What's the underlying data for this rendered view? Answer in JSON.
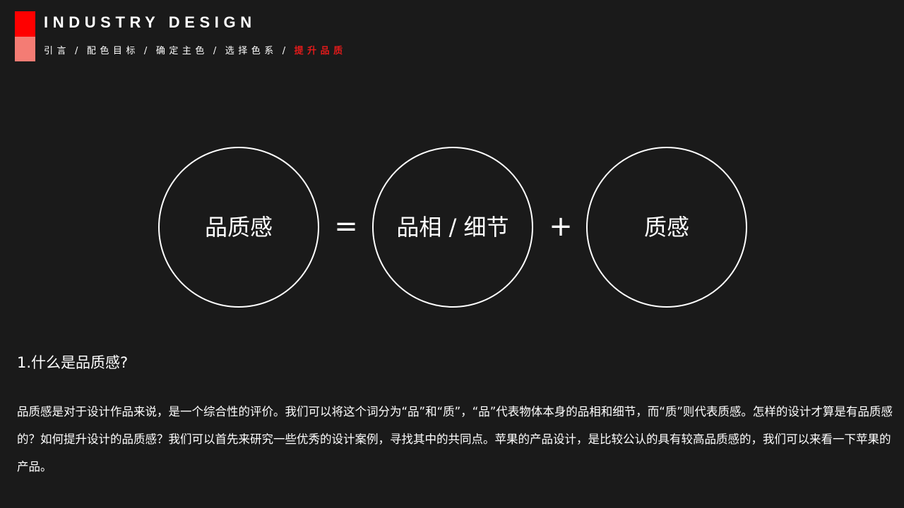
{
  "header": {
    "title": "INDUSTRY DESIGN",
    "brand_colors": {
      "primary": "#ff0000",
      "secondary": "#f47c74"
    }
  },
  "breadcrumb": {
    "items": [
      {
        "label": "引言",
        "active": false
      },
      {
        "label": "配色目标",
        "active": false
      },
      {
        "label": "确定主色",
        "active": false
      },
      {
        "label": "选择色系",
        "active": false
      },
      {
        "label": "提升品质",
        "active": true
      }
    ],
    "separator": "/",
    "active_color": "#e01a1a"
  },
  "equation": {
    "left": "品质感",
    "equals": "=",
    "middle": "品相 / 细节",
    "plus": "+",
    "right": "质感"
  },
  "section": {
    "heading": "1.什么是品质感?",
    "paragraph": "品质感是对于设计作品来说，是一个综合性的评价。我们可以将这个词分为“品”和“质”，“品”代表物体本身的品相和细节，而“质”则代表质感。怎样的设计才算是有品质感的？如何提升设计的品质感？我们可以首先来研究一些优秀的设计案例，寻找其中的共同点。苹果的产品设计，是比较公认的具有较高品质感的，我们可以来看一下苹果的产品。"
  }
}
